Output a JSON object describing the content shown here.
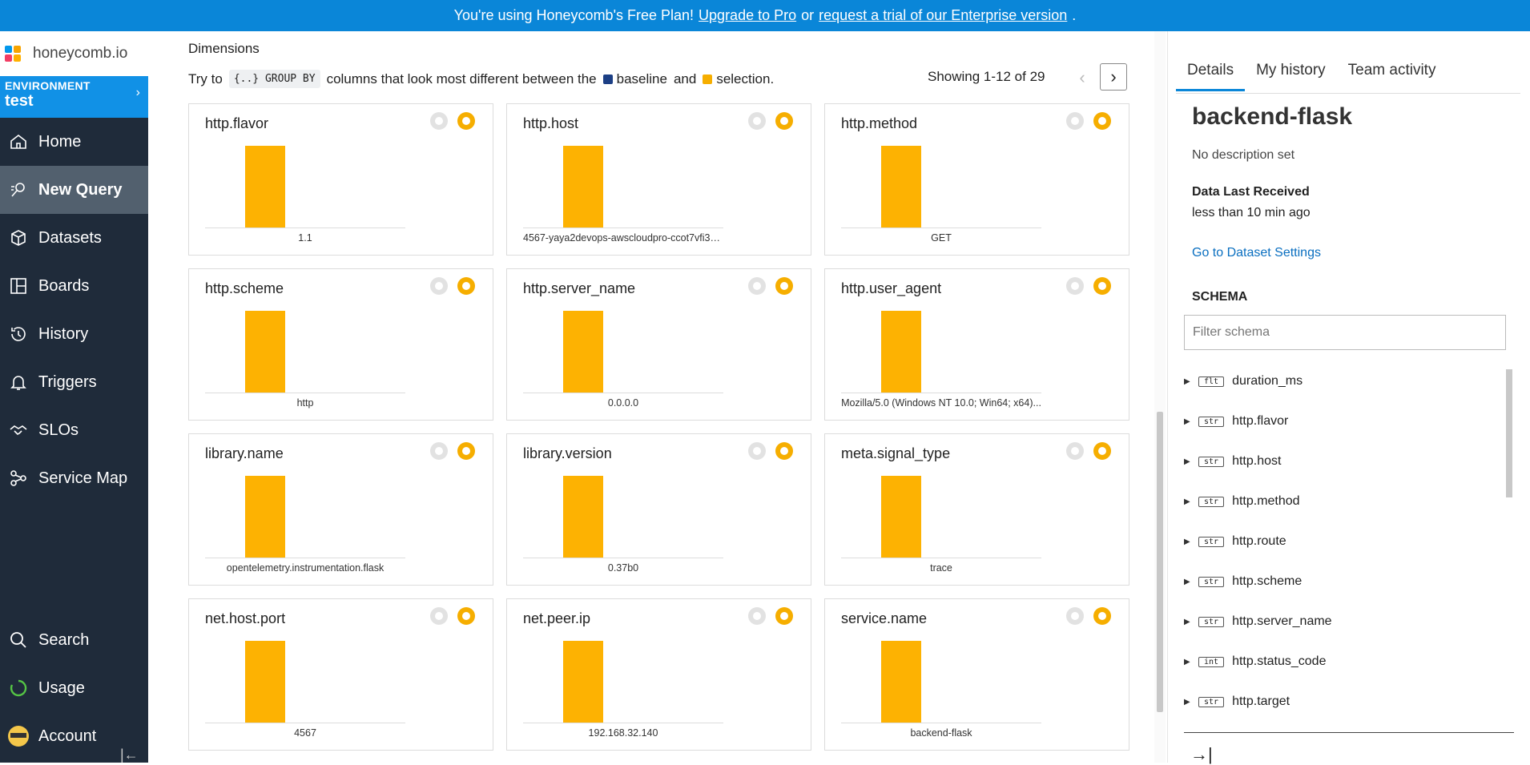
{
  "banner": {
    "prefix": "You're using Honeycomb's Free Plan!",
    "upgrade": "Upgrade to Pro",
    "or": "or",
    "trial": "request a trial of our Enterprise version",
    "suffix": "."
  },
  "logo": "honeycomb.io",
  "environment": {
    "label": "ENVIRONMENT",
    "name": "test"
  },
  "nav": [
    {
      "label": "Home",
      "icon": "home-icon"
    },
    {
      "label": "New Query",
      "icon": "query-icon",
      "active": true
    },
    {
      "label": "Datasets",
      "icon": "cube-icon"
    },
    {
      "label": "Boards",
      "icon": "boards-icon"
    },
    {
      "label": "History",
      "icon": "history-icon"
    },
    {
      "label": "Triggers",
      "icon": "bell-icon"
    },
    {
      "label": "SLOs",
      "icon": "handshake-icon"
    },
    {
      "label": "Service Map",
      "icon": "service-map-icon"
    }
  ],
  "nav_bottom": [
    {
      "label": "Search",
      "icon": "search-icon"
    },
    {
      "label": "Usage",
      "icon": "usage-icon"
    },
    {
      "label": "Account",
      "icon": "avatar-icon"
    }
  ],
  "main": {
    "title": "Dimensions",
    "hint_pre": "Try to",
    "group_by": "{..}  GROUP BY",
    "hint_mid": "columns that look most different between the",
    "baseline": "baseline",
    "and": "and",
    "selection": "selection",
    "dot": ".",
    "showing": "Showing 1-12 of 29",
    "colors": {
      "baseline": "#1c3f85",
      "selection": "#f6ae00"
    }
  },
  "cards": [
    {
      "title": "http.flavor",
      "value": "1.1"
    },
    {
      "title": "http.host",
      "value": "4567-yaya2devops-awscloudpro-ccot7vfi3p..."
    },
    {
      "title": "http.method",
      "value": "GET"
    },
    {
      "title": "http.scheme",
      "value": "http"
    },
    {
      "title": "http.server_name",
      "value": "0.0.0.0"
    },
    {
      "title": "http.user_agent",
      "value": "Mozilla/5.0 (Windows NT 10.0; Win64; x64)..."
    },
    {
      "title": "library.name",
      "value": "opentelemetry.instrumentation.flask"
    },
    {
      "title": "library.version",
      "value": "0.37b0"
    },
    {
      "title": "meta.signal_type",
      "value": "trace"
    },
    {
      "title": "net.host.port",
      "value": "4567"
    },
    {
      "title": "net.peer.ip",
      "value": "192.168.32.140"
    },
    {
      "title": "service.name",
      "value": "backend-flask"
    }
  ],
  "panel": {
    "tabs": [
      "Details",
      "My history",
      "Team activity"
    ],
    "dataset": "backend-flask",
    "description": "No description set",
    "dlr_label": "Data Last Received",
    "dlr_value": "less than 10 min ago",
    "settings_link": "Go to Dataset Settings",
    "schema_heading": "SCHEMA",
    "filter_placeholder": "Filter schema",
    "schema": [
      {
        "type": "flt",
        "name": "duration_ms"
      },
      {
        "type": "str",
        "name": "http.flavor"
      },
      {
        "type": "str",
        "name": "http.host"
      },
      {
        "type": "str",
        "name": "http.method"
      },
      {
        "type": "str",
        "name": "http.route"
      },
      {
        "type": "str",
        "name": "http.scheme"
      },
      {
        "type": "str",
        "name": "http.server_name"
      },
      {
        "type": "int",
        "name": "http.status_code"
      },
      {
        "type": "str",
        "name": "http.target"
      }
    ]
  }
}
